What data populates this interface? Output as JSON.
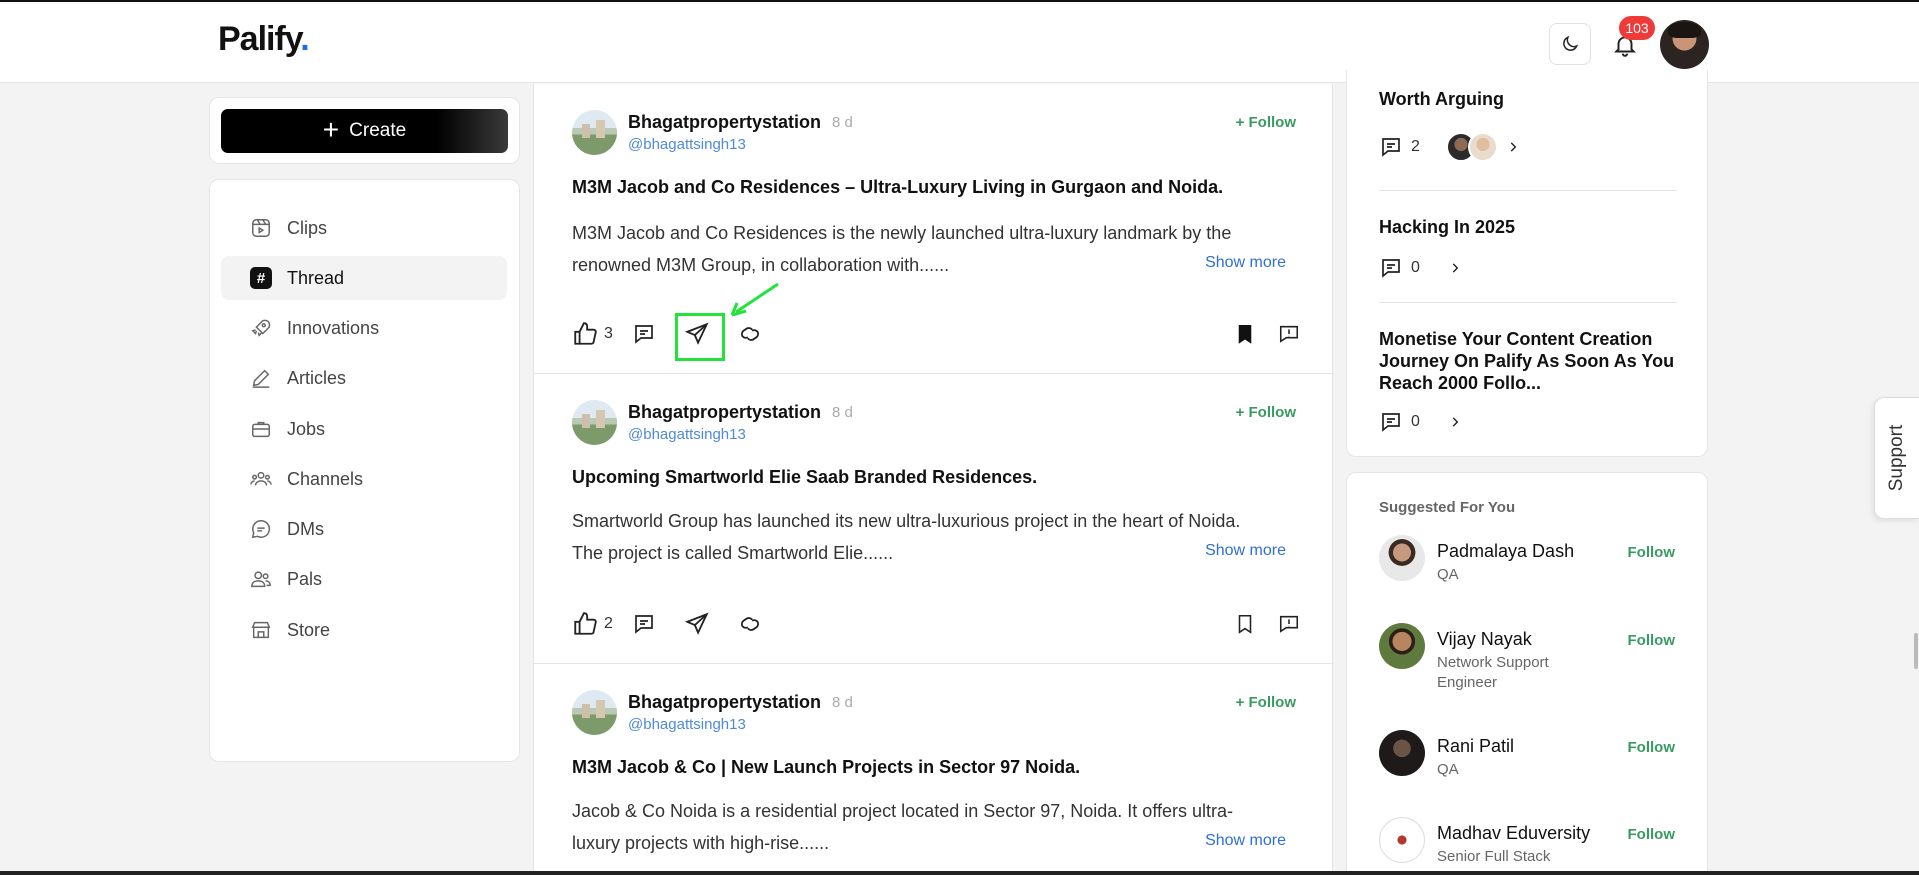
{
  "header": {
    "logo": "Palify",
    "logo_dot": ".",
    "notification_count": "103"
  },
  "sidebar": {
    "create_label": "Create",
    "items": [
      {
        "label": "Clips",
        "icon": "clips-icon"
      },
      {
        "label": "Thread",
        "icon": "hash-icon",
        "active": true
      },
      {
        "label": "Innovations",
        "icon": "rocket-icon"
      },
      {
        "label": "Articles",
        "icon": "pencil-icon"
      },
      {
        "label": "Jobs",
        "icon": "briefcase-icon"
      },
      {
        "label": "Channels",
        "icon": "users-icon"
      },
      {
        "label": "DMs",
        "icon": "chat-icon"
      },
      {
        "label": "Pals",
        "icon": "pals-icon"
      },
      {
        "label": "Store",
        "icon": "store-icon"
      }
    ]
  },
  "posts": [
    {
      "author": "Bhagatpropertystation",
      "time": "8 d",
      "handle": "@bhagattsingh13",
      "follow": "+ Follow",
      "title": "M3M Jacob and Co Residences –  Ultra-Luxury Living in Gurgaon and Noida.",
      "body_line1": "M3M Jacob and Co Residences is the newly launched ultra-luxury landmark by the",
      "body_line2": "renowned M3M Group, in collaboration with......",
      "show_more": "Show more",
      "likes": "3",
      "bookmarked": true
    },
    {
      "author": "Bhagatpropertystation",
      "time": "8 d",
      "handle": "@bhagattsingh13",
      "follow": "+ Follow",
      "title": "Upcoming Smartworld Elie Saab Branded Residences.",
      "body_line1": "Smartworld Group has launched its new ultra-luxurious project in the heart of Noida.",
      "body_line2": "The project is called Smartworld Elie......",
      "show_more": "Show more",
      "likes": "2",
      "bookmarked": false
    },
    {
      "author": "Bhagatpropertystation",
      "time": "8 d",
      "handle": "@bhagattsingh13",
      "follow": "+ Follow",
      "title": "M3M Jacob & Co | New Launch Projects in Sector 97 Noida.",
      "body_line1": "Jacob & Co Noida is a residential project located in Sector 97, Noida. It offers ultra-",
      "body_line2": "luxury projects with high-rise......",
      "show_more": "Show more"
    }
  ],
  "trending": [
    {
      "title": "Worth Arguing",
      "comments": "2"
    },
    {
      "title": "Hacking In 2025",
      "comments": "0"
    },
    {
      "title": "Monetise Your Content Creation Journey On Palify As Soon As You Reach 2000 Follo...",
      "comments": "0"
    }
  ],
  "suggested": {
    "heading": "Suggested For You",
    "people": [
      {
        "name": "Padmalaya Dash",
        "role": "QA",
        "follow": "Follow"
      },
      {
        "name": "Vijay Nayak",
        "role": "Network Support Engineer",
        "follow": "Follow"
      },
      {
        "name": "Rani Patil",
        "role": "QA",
        "follow": "Follow"
      },
      {
        "name": "Madhav Eduversity",
        "role": "Senior Full Stack",
        "follow": "Follow"
      }
    ]
  },
  "support_label": "Support",
  "colors": {
    "accent_green": "#3a9a63",
    "link_blue": "#2f6fd6",
    "badge_red": "#ef3a3a",
    "highlight_green": "#22e33a"
  }
}
